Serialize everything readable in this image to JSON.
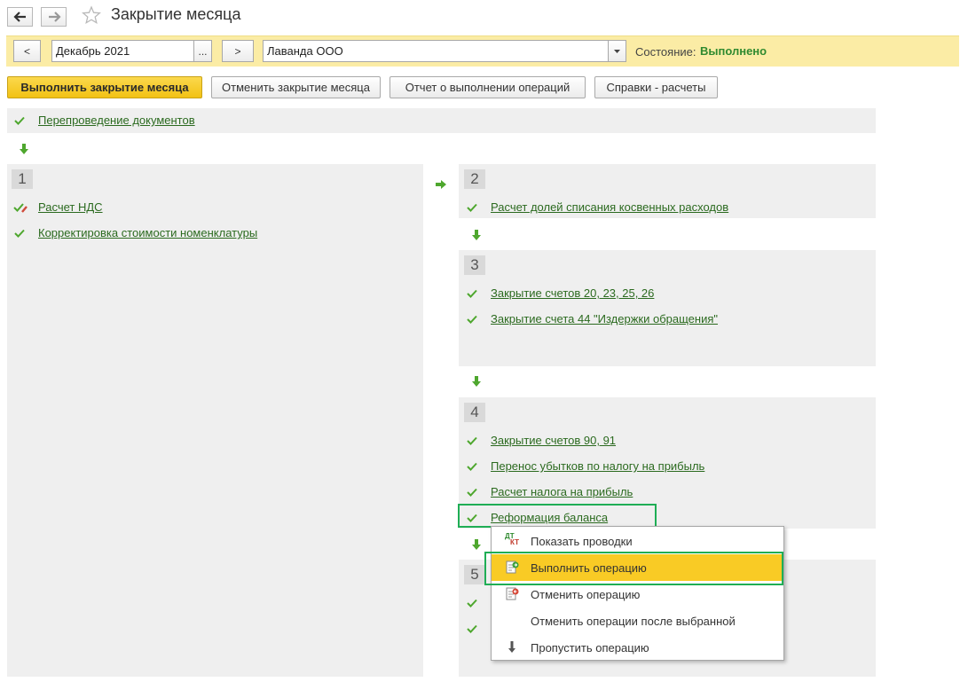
{
  "window": {
    "title": "Закрытие месяца",
    "back_icon": "arrow-left-icon",
    "forward_icon": "arrow-right-icon",
    "favorite_icon": "star-icon"
  },
  "toolbar": {
    "prev_label": "<",
    "period_value": "Декабрь 2021",
    "period_choose_label": "...",
    "next_label": ">",
    "org_value": "Лаванда ООО",
    "state_label": "Состояние:",
    "state_value": "Выполнено",
    "state_color": "#2f8a2f"
  },
  "actions": {
    "run_label": "Выполнить закрытие месяца",
    "cancel_label": "Отменить закрытие месяца",
    "report_label": "Отчет о выполнении операций",
    "refs_label": "Справки - расчеты"
  },
  "sections": {
    "pre": {
      "items": [
        "Перепроведение документов"
      ]
    },
    "s1": {
      "number": "1",
      "items": [
        "Расчет НДС",
        "Корректировка стоимости номенклатуры"
      ]
    },
    "s2": {
      "number": "2",
      "items": [
        "Расчет долей списания косвенных расходов"
      ]
    },
    "s3": {
      "number": "3",
      "items": [
        "Закрытие счетов 20, 23, 25, 26",
        "Закрытие счета 44 \"Издержки обращения\""
      ]
    },
    "s4": {
      "number": "4",
      "items": [
        "Закрытие счетов 90, 91",
        "Перенос убытков по налогу на прибыль",
        "Расчет налога на прибыль",
        "Реформация баланса"
      ]
    },
    "s5": {
      "number": "5"
    }
  },
  "context_menu": {
    "items": [
      {
        "label": "Показать проводки",
        "icon": "dt-kt-icon",
        "highlighted": false
      },
      {
        "label": "Выполнить операцию",
        "icon": "run-document-icon",
        "highlighted": true
      },
      {
        "label": "Отменить операцию",
        "icon": "cancel-document-icon",
        "highlighted": false
      },
      {
        "label": "Отменить операции после выбранной",
        "icon": "",
        "highlighted": false
      },
      {
        "label": "Пропустить операцию",
        "icon": "arrow-down-icon",
        "highlighted": false
      }
    ],
    "dt_label": "ДТ",
    "kt_label": "КТ"
  },
  "colors": {
    "link": "#2b6a1f",
    "check": "#4ea72e",
    "highlight": "#f9cb25",
    "outline": "#1fae55",
    "header_bar": "#fbeca5"
  }
}
